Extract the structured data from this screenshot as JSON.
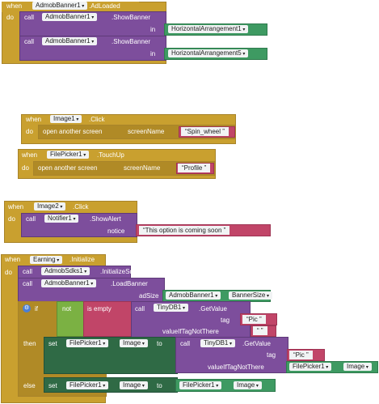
{
  "kw": {
    "when": "when",
    "do": "do",
    "call": "call",
    "in": "in",
    "screenName": "screenName",
    "notice": "notice",
    "adSize": "adSize",
    "tag": "tag",
    "valueIfTagNotThere": "valueIfTagNotThere",
    "if": "if",
    "then": "then",
    "else": "else",
    "set": "set",
    "to": "to",
    "not": "not",
    "is_empty": "is empty",
    "open_another_screen": "open another screen"
  },
  "block1": {
    "component": "AdmobBanner1",
    "event": ".AdLoaded",
    "call_component": "AdmobBanner1",
    "method": ".ShowBanner",
    "in1": "HorizontalArrangement1",
    "in2": "HorizontalArrangement5"
  },
  "block2": {
    "component": "Image1",
    "event": ".Click",
    "screen": "Spin_wheel"
  },
  "block3": {
    "component": "FilePicker1",
    "event": ".TouchUp",
    "screen": "Profile"
  },
  "block4": {
    "component": "Image2",
    "event": ".Click",
    "call_component": "Notifier1",
    "method": ".ShowAlert",
    "notice": "This option is coming soon"
  },
  "block5": {
    "component": "Earning",
    "event": ".Initialize",
    "sdk_component": "AdmobSdks1",
    "sdk_method": ".InitializeSdk",
    "banner_component": "AdmobBanner1",
    "banner_method": ".LoadBanner",
    "adsize_component": "AdmobBanner1",
    "adsize_prop": "BannerSize",
    "db_component": "TinyDB1",
    "db_method": ".GetValue",
    "tag": "Pic",
    "empty_text": "",
    "set_component": "FilePicker1",
    "set_prop": "Image",
    "else_source": "FilePicker1",
    "else_prop": "Image"
  }
}
